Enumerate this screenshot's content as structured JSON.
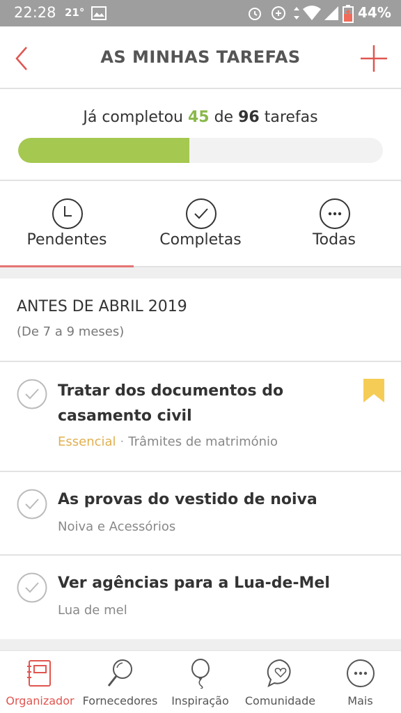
{
  "status_bar": {
    "time": "22:28",
    "temperature": "21°",
    "battery": "44%"
  },
  "header": {
    "title": "AS MINHAS TAREFAS"
  },
  "progress": {
    "prefix": "Já completou",
    "completed": "45",
    "middle": "de",
    "total": "96",
    "suffix": "tarefas",
    "fraction": 0.469
  },
  "tabs": [
    {
      "label": "Pendentes",
      "icon": "clock-icon",
      "active": true
    },
    {
      "label": "Completas",
      "icon": "check-circle-icon",
      "active": false
    },
    {
      "label": "Todas",
      "icon": "more-circle-icon",
      "active": false
    }
  ],
  "section": {
    "title": "ANTES DE ABRIL 2019",
    "subtitle": "(De 7 a 9 meses)"
  },
  "tasks": [
    {
      "title_line1": "Tratar dos documentos do",
      "title_line2": "casamento civil",
      "tag": "Essencial",
      "separator": "·",
      "category": "Trâmites de matrimónio",
      "bookmarked": true
    },
    {
      "title": "As provas do vestido de noiva",
      "category": "Noiva e Acessórios"
    },
    {
      "title": "Ver agências para a Lua-de-Mel",
      "category": "Lua de mel"
    }
  ],
  "bottom_nav": [
    {
      "label": "Organizador",
      "icon": "notebook-icon",
      "active": true
    },
    {
      "label": "Fornecedores",
      "icon": "magnifier-icon",
      "active": false
    },
    {
      "label": "Inspiração",
      "icon": "balloon-icon",
      "active": false
    },
    {
      "label": "Comunidade",
      "icon": "chat-heart-icon",
      "active": false
    },
    {
      "label": "Mais",
      "icon": "more-icon",
      "active": false
    }
  ],
  "colors": {
    "accent": "#e05550",
    "progress_fill": "#a5c850",
    "completed_count": "#8ab84a",
    "essential": "#e0b050",
    "bookmark": "#f5cc55"
  }
}
